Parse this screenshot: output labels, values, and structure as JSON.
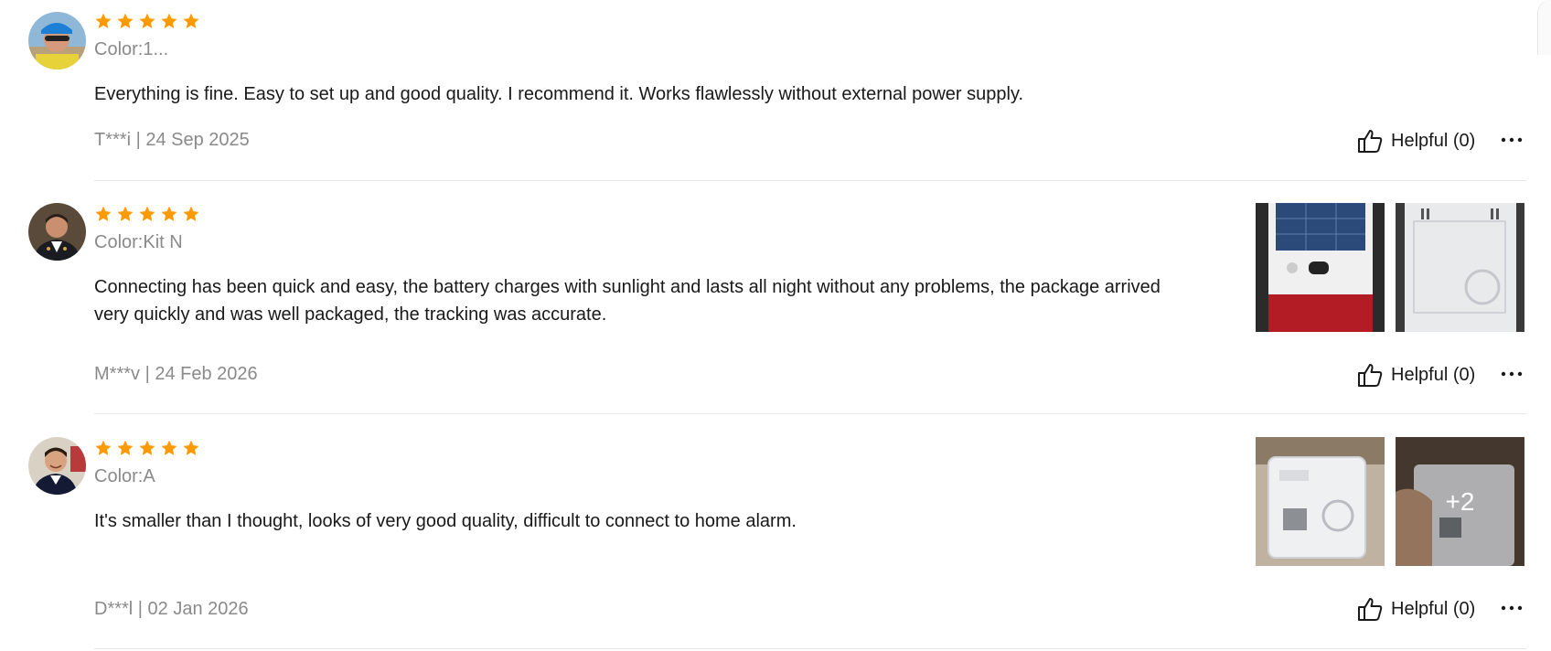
{
  "accent_star_color": "#ff9a00",
  "reviews": [
    {
      "rating": 5,
      "color": "Color:1...",
      "text": "Everything is fine. Easy to set up and good quality. I recommend it. Works flawlessly without external power supply.",
      "author_date": "T***i | 24 Sep 2025",
      "helpful": "Helpful (0)"
    },
    {
      "rating": 5,
      "color": "Color:Kit N",
      "text": "Connecting has been quick and easy, the battery charges with sunlight and lasts all night without any problems, the package arrived very quickly and was well packaged, the tracking was accurate.",
      "author_date": "M***v | 24 Feb 2026",
      "helpful": "Helpful (0)"
    },
    {
      "rating": 5,
      "color": "Color:A",
      "text": "It's smaller than I thought, looks of very good quality, difficult to connect to home alarm.",
      "author_date": "D***l | 02 Jan 2026",
      "helpful": "Helpful (0)",
      "more_photos": "+2"
    }
  ],
  "icons": {
    "star": "star-icon",
    "helpful": "thumbs-up-icon",
    "more": "more-options-icon"
  }
}
